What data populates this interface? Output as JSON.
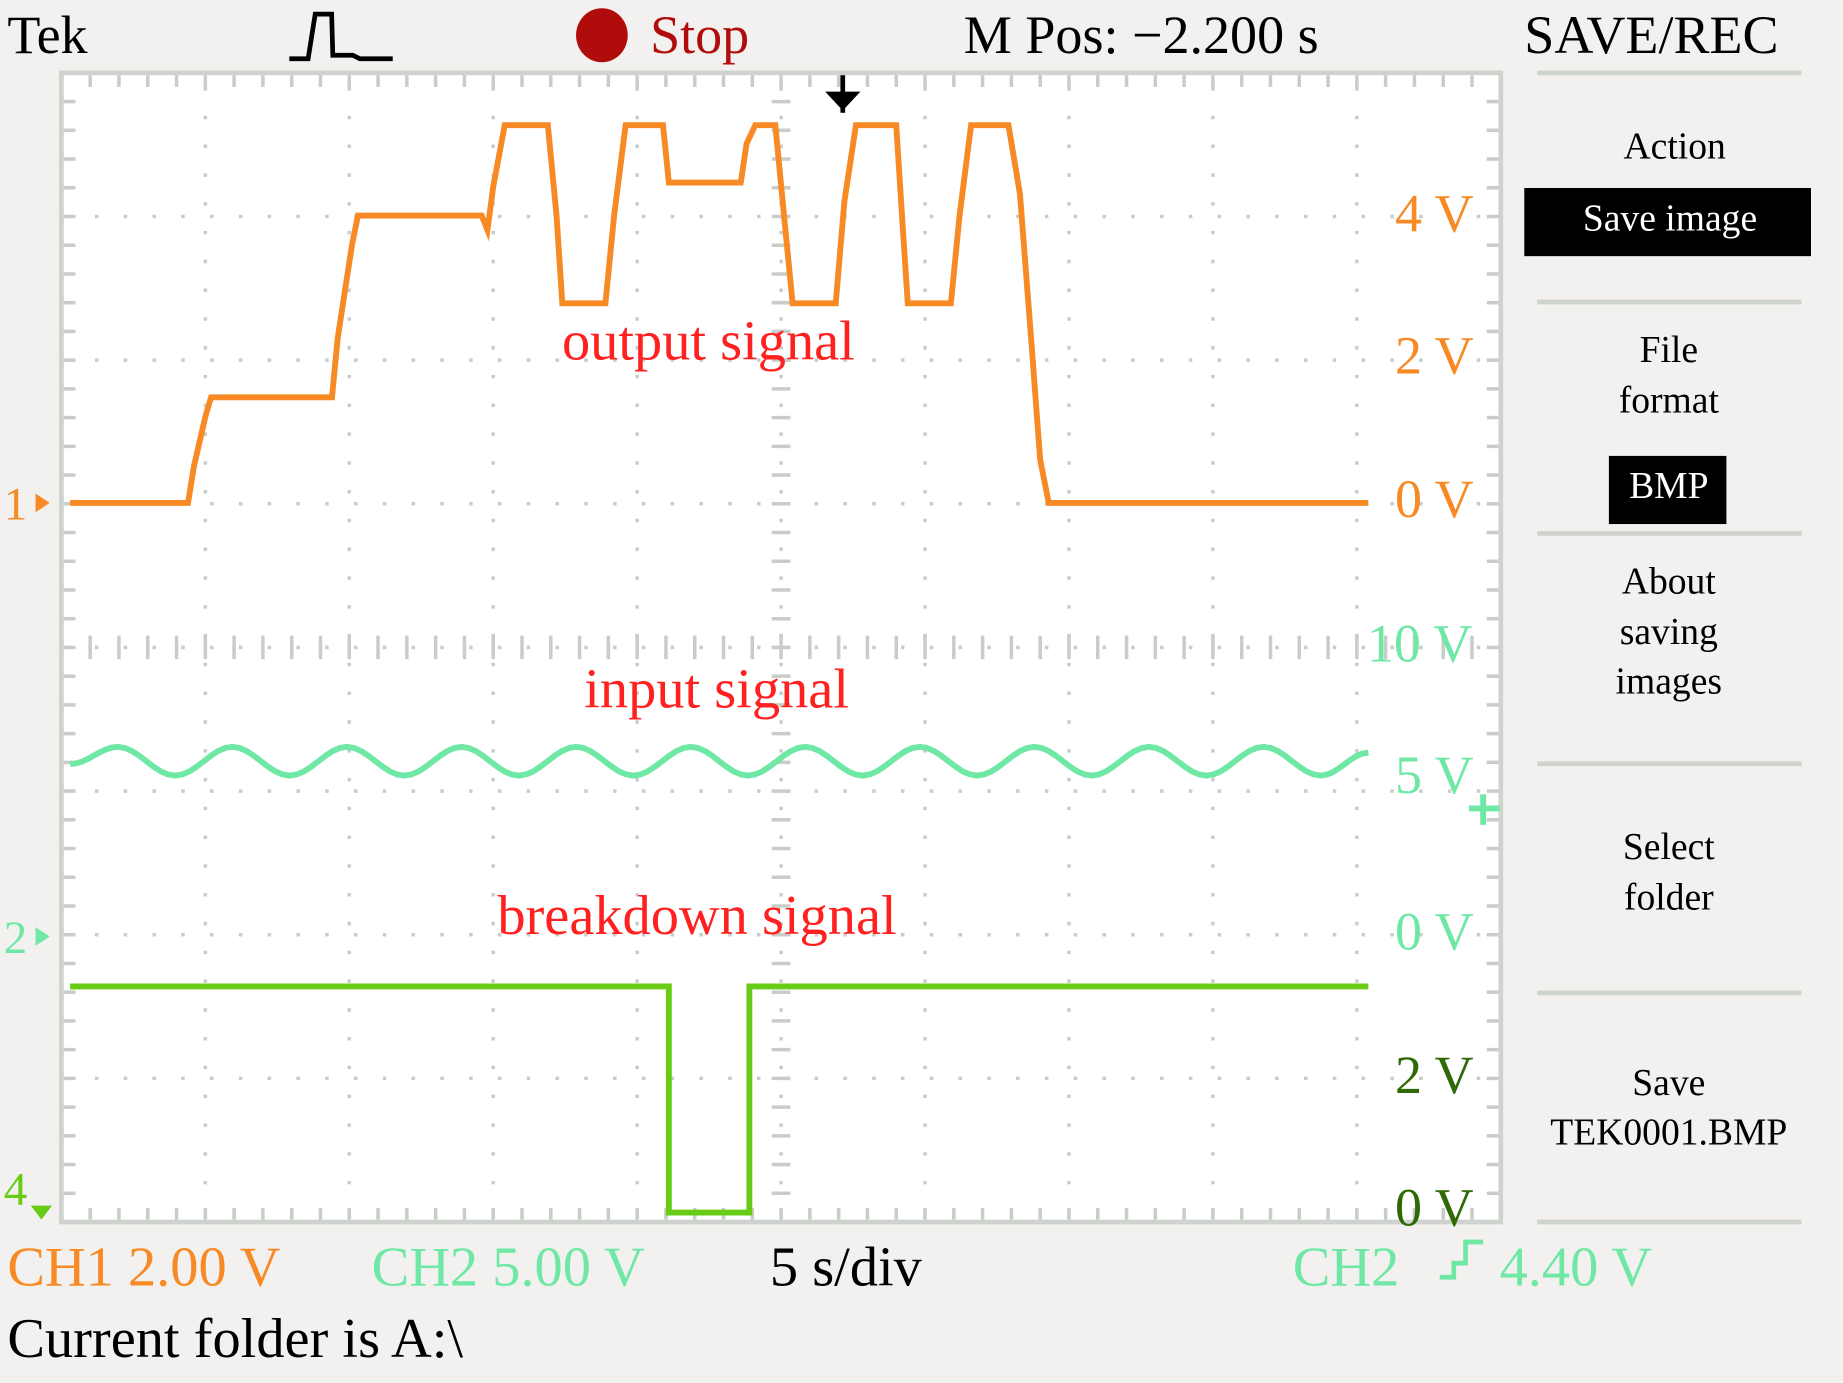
{
  "header": {
    "brand": "Tek",
    "acq_state": "Stop",
    "acq_state_color": "#b00c0c",
    "horizontal_position": "M Pos: −2.200 s",
    "menu_title": "SAVE/REC"
  },
  "menu": {
    "items": [
      {
        "label_lines": [
          "Action"
        ],
        "value": "Save image"
      },
      {
        "label_lines": [
          "File",
          "format"
        ],
        "value": "BMP"
      },
      {
        "label_lines": [
          "About",
          "saving",
          "images"
        ]
      },
      {
        "label_lines": [
          "Select",
          "folder"
        ]
      },
      {
        "label_lines": [
          "Save",
          "TEK0001.BMP"
        ]
      }
    ]
  },
  "status": {
    "ch1_scale": "CH1 2.00 V",
    "ch2_scale": "CH2 5.00 V",
    "timebase": "5 s/div",
    "trigger_source": "CH2",
    "trigger_slope_icon": "rising-edge-icon",
    "trigger_level": "4.40 V",
    "folder": "Current folder is A:\\"
  },
  "colors": {
    "ch1": "#f78a25",
    "ch2": "#6ee8a4",
    "ch4": "#68cc16",
    "ch4_label": "#2f6a06",
    "annotation": "#ff2020",
    "background": "#f2f1ef",
    "screen": "#ffffff"
  },
  "chart_data": {
    "type": "line",
    "x_unit": "s",
    "xlim": [
      0,
      50
    ],
    "x_divisions": 10,
    "y_divisions": 8,
    "grid": true,
    "trigger_time": 27.1,
    "annotations": [
      "output signal",
      "input signal",
      "breakdown signal"
    ],
    "series": [
      {
        "channel": "1",
        "scale_label": "2.00 V/div",
        "axis_labels": [
          "4 V",
          "2 V",
          "0 V"
        ],
        "x": [
          0.3,
          4.4,
          4.6,
          5.0,
          5.2,
          9.4,
          9.6,
          10.1,
          10.3,
          14.6,
          14.8,
          15.0,
          15.4,
          16.9,
          17.2,
          17.4,
          18.9,
          19.2,
          19.6,
          20.9,
          21.1,
          23.6,
          23.8,
          24.1,
          24.8,
          25.1,
          25.4,
          26.9,
          27.2,
          27.6,
          29.0,
          29.2,
          29.4,
          30.9,
          31.2,
          31.6,
          32.9,
          33.3,
          33.7,
          34.0,
          34.3,
          45.4
        ],
        "y": [
          0,
          0,
          0.5,
          1.2,
          1.47,
          1.47,
          2.3,
          3.6,
          4.0,
          4.0,
          3.8,
          4.4,
          5.26,
          5.26,
          4.0,
          2.78,
          2.78,
          4.0,
          5.26,
          5.26,
          4.46,
          4.46,
          5.0,
          5.26,
          5.26,
          4.0,
          2.78,
          2.78,
          4.2,
          5.26,
          5.26,
          4.0,
          2.78,
          2.78,
          4.0,
          5.26,
          5.26,
          4.3,
          2.2,
          0.6,
          0,
          0
        ]
      },
      {
        "channel": "2",
        "scale_label": "5.00 V/div",
        "axis_labels": [
          "10 V",
          "5 V",
          "0 V"
        ],
        "x": [
          0.3,
          1.96,
          3.95,
          5.94,
          7.93,
          9.92,
          11.91,
          13.9,
          15.89,
          17.88,
          19.87,
          21.86,
          23.85,
          25.84,
          27.83,
          29.82,
          31.81,
          33.8,
          35.79,
          37.78,
          39.77,
          41.76,
          43.75,
          45.4
        ],
        "y": [
          6.0,
          6.6,
          5.6,
          6.6,
          5.6,
          6.6,
          5.6,
          6.6,
          5.6,
          6.6,
          5.6,
          6.6,
          5.6,
          6.6,
          5.6,
          6.6,
          5.6,
          6.6,
          5.6,
          6.6,
          5.6,
          6.6,
          5.6,
          6.4
        ]
      },
      {
        "channel": "4",
        "scale_label": "2 V/div",
        "axis_labels": [
          "2 V",
          "0 V"
        ],
        "x": [
          0.3,
          21.1,
          21.1,
          23.9,
          23.9,
          45.4
        ],
        "y": [
          3.15,
          3.15,
          0,
          0,
          3.15,
          3.15
        ]
      }
    ]
  }
}
